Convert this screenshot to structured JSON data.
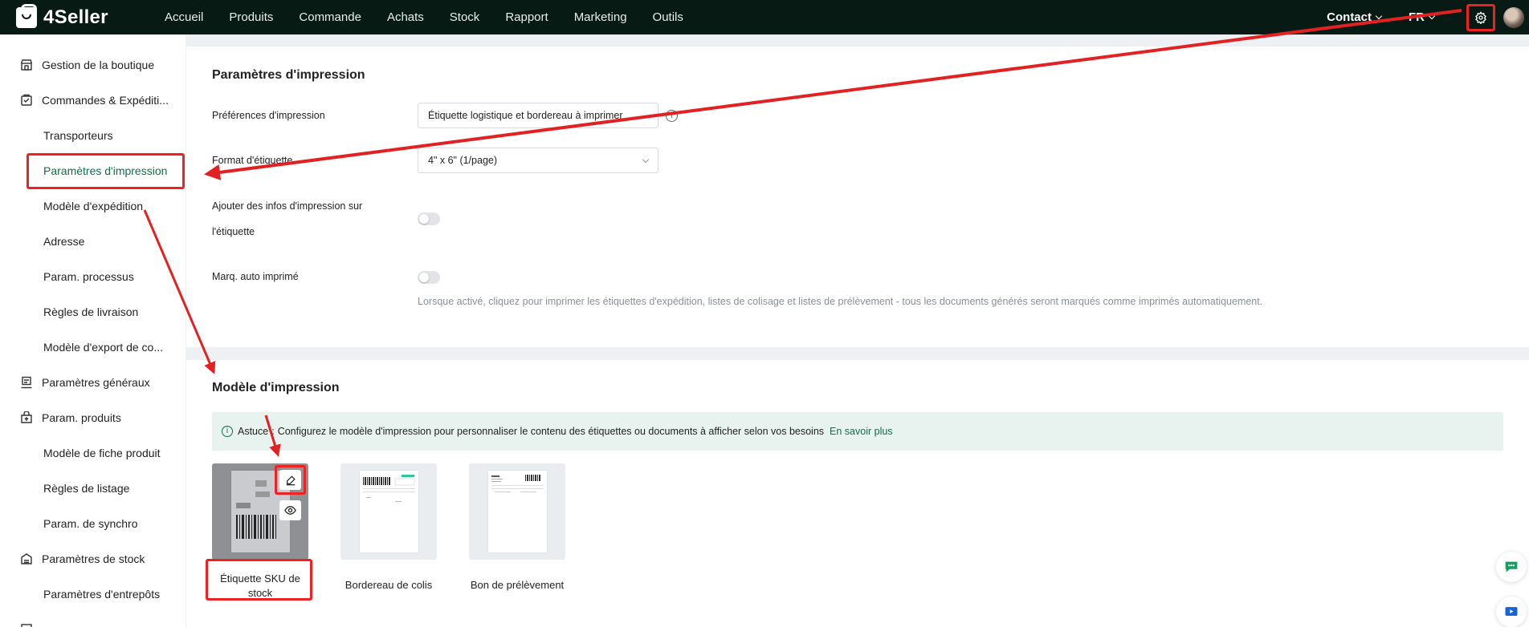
{
  "brand": {
    "name": "4Seller"
  },
  "nav": {
    "items": [
      "Accueil",
      "Produits",
      "Commande",
      "Achats",
      "Stock",
      "Rapport",
      "Marketing",
      "Outils"
    ]
  },
  "top_right": {
    "contact": "Contact",
    "language": "FR"
  },
  "sidebar": {
    "items": [
      {
        "label": "Gestion de la boutique",
        "type": "group",
        "icon": "store-icon"
      },
      {
        "label": "Commandes & Expéditi...",
        "type": "group",
        "icon": "orders-icon"
      },
      {
        "label": "Transporteurs",
        "type": "sub"
      },
      {
        "label": "Paramètres d'impression",
        "type": "sub",
        "active": true
      },
      {
        "label": "Modèle d'expédition",
        "type": "sub"
      },
      {
        "label": "Adresse",
        "type": "sub"
      },
      {
        "label": "Param. processus",
        "type": "sub"
      },
      {
        "label": "Règles de livraison",
        "type": "sub"
      },
      {
        "label": "Modèle d'export de co...",
        "type": "sub"
      },
      {
        "label": "Paramètres généraux",
        "type": "group",
        "icon": "general-settings-icon"
      },
      {
        "label": "Param. produits",
        "type": "group",
        "icon": "product-icon"
      },
      {
        "label": "Modèle de fiche produit",
        "type": "sub"
      },
      {
        "label": "Règles de listage",
        "type": "sub"
      },
      {
        "label": "Param. de synchro",
        "type": "sub"
      },
      {
        "label": "Paramètres de stock",
        "type": "group",
        "icon": "stock-icon"
      },
      {
        "label": "Paramètres d'entrepôts",
        "type": "sub"
      }
    ]
  },
  "print_settings": {
    "title": "Paramètres d'impression",
    "preference_label": "Préférences d'impression",
    "preference_value": "Étiquette logistique et bordereau à imprimer",
    "format_label": "Format d'étiquette",
    "format_value": "4\" x 6\" (1/page)",
    "add_info_label_line1": "Ajouter des infos d'impression sur",
    "add_info_label_line2": "l'étiquette",
    "auto_mark_label": "Marq. auto imprimé",
    "auto_mark_hint": "Lorsque activé, cliquez pour imprimer les étiquettes d'expédition, listes de colisage et listes de prélèvement - tous les documents générés seront marqués comme imprimés automatiquement."
  },
  "print_templates": {
    "title": "Modèle d'impression",
    "tip_prefix": "Astuce",
    "tip_text": "Configurez le modèle d'impression pour personnaliser le contenu des étiquettes ou documents à afficher selon vos besoins",
    "tip_link": "En savoir plus",
    "cards": [
      {
        "label_line1": "Étiquette SKU de",
        "label_line2": "stock"
      },
      {
        "label": "Bordereau de colis"
      },
      {
        "label": "Bon de prélèvement"
      }
    ]
  },
  "colors": {
    "topbar": "#071a13",
    "accent": "#0d6e48",
    "annotation": "#e22222"
  }
}
